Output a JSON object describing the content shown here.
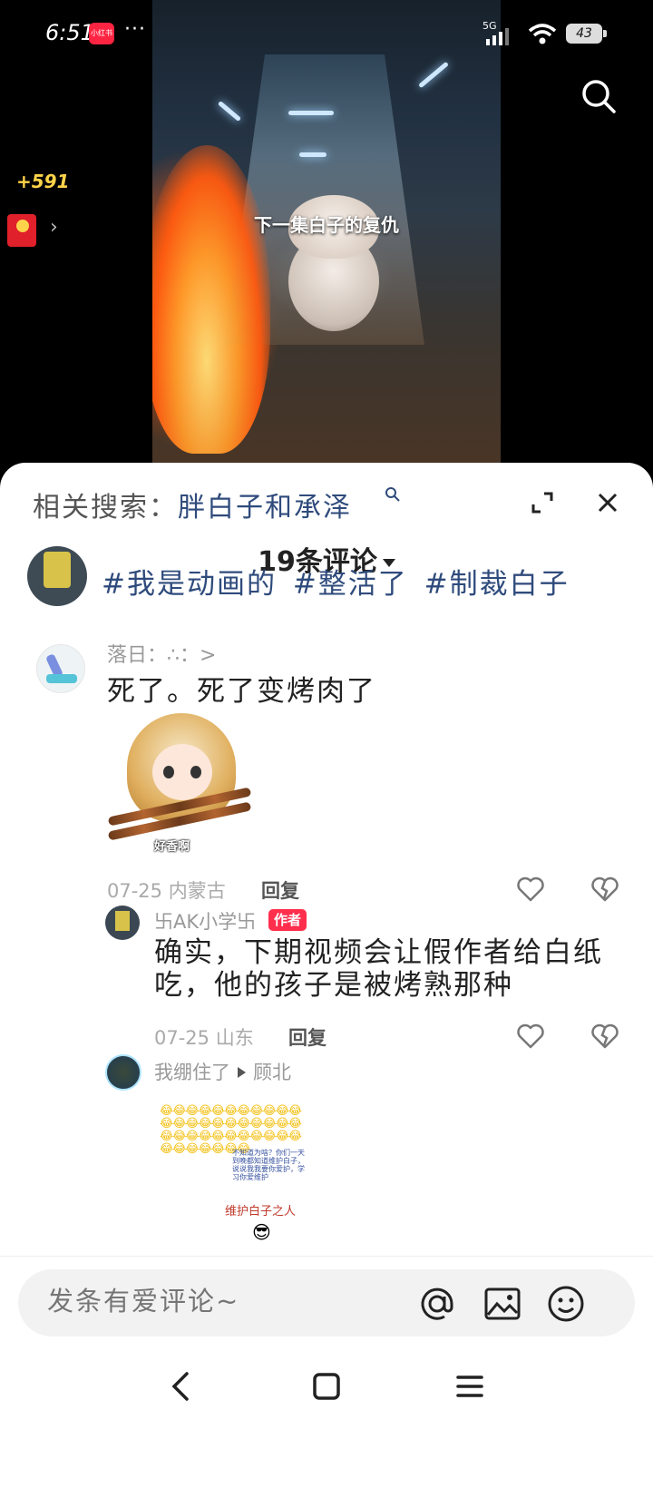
{
  "status": {
    "time": "6:51",
    "app_badge": "小红书",
    "more": "···",
    "network": "5G",
    "battery": "43"
  },
  "video": {
    "caption": "下一集白子的复仇"
  },
  "side": {
    "bonus": "+591",
    "chevron": "›"
  },
  "sheet": {
    "related_label": "相关搜索：",
    "related_keyword": "胖白子和承泽",
    "count_title": "19条评论",
    "hashtags": "#我是动画的 #整活了 #制裁白子"
  },
  "comments": [
    {
      "name": "落日：∴：>",
      "text": "死了。死了变烤肉了",
      "sticker_caption": "好香啊",
      "date": "07-25",
      "location": "内蒙古",
      "reply_label": "回复"
    }
  ],
  "replies": [
    {
      "name": "卐AK小学卐",
      "badge": "作者",
      "text": "确实，下期视频会让假作者给白纸吃，他的孩子是被烤熟那种",
      "date": "07-25",
      "location": "山东",
      "reply_label": "回复"
    },
    {
      "name": "我绷住了",
      "target": "顾北",
      "meme_emojis": "😂😂😂😂😂😂😂😂😂😂😂😂😂😂😂😂😂😂😂😂😂😂😂😂😂😂😂😂😂😂😂😂😂😂😂😂😂😂😂😂",
      "meme_note": "不知道为啥？你们一天到晚都知道维护白子，说说我我要你爱护，学习你爱维护",
      "meme_caption": "维护白子之人",
      "meme_face": "😎"
    }
  ],
  "input": {
    "placeholder": "发条有爱评论~"
  },
  "icons": {
    "search": "search-icon",
    "expand": "expand-icon",
    "close": "close-icon",
    "like": "heart-icon",
    "dislike": "broken-heart-icon",
    "mention": "at-icon",
    "image": "image-icon",
    "emoji": "emoji-icon",
    "back": "back-icon",
    "home": "home-icon",
    "menu": "menu-icon"
  },
  "colors": {
    "accent": "#ff2442",
    "link": "#2f4b7c",
    "bonus": "#ffd34a"
  }
}
